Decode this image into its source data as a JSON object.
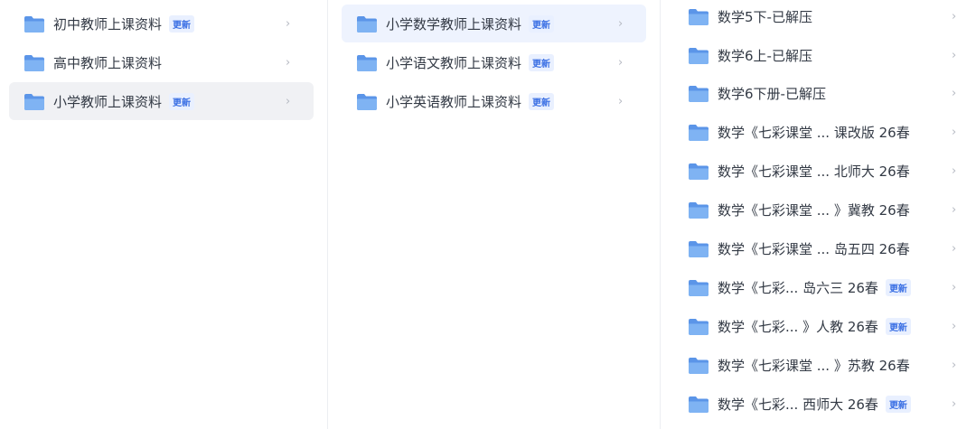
{
  "colors": {
    "accent": "#3a6fe4",
    "folder": "#6aa2ee",
    "selected_bg_1": "#f0f1f4",
    "selected_bg_2": "#eef3fe"
  },
  "col1": {
    "items": [
      {
        "label": "初中教师上课资料",
        "badge": "更新"
      },
      {
        "label": "高中教师上课资料",
        "badge": ""
      },
      {
        "label": "小学教师上课资料",
        "badge": "更新"
      }
    ],
    "chevron": "›"
  },
  "col2": {
    "items": [
      {
        "label": "小学数学教师上课资料",
        "badge": "更新"
      },
      {
        "label": "小学语文教师上课资料",
        "badge": "更新"
      },
      {
        "label": "小学英语教师上课资料",
        "badge": "更新"
      }
    ],
    "chevron": "›"
  },
  "col3": {
    "items": [
      {
        "label": "数学5下-已解压",
        "badge": ""
      },
      {
        "label": "数学6上-已解压",
        "badge": ""
      },
      {
        "label": "数学6下册-已解压",
        "badge": ""
      },
      {
        "label": "数学《七彩课堂 ...  课改版 26春",
        "badge": ""
      },
      {
        "label": "数学《七彩课堂 ...  北师大 26春",
        "badge": ""
      },
      {
        "label": "数学《七彩课堂 ...  》冀教 26春",
        "badge": ""
      },
      {
        "label": "数学《七彩课堂 ...  岛五四 26春",
        "badge": ""
      },
      {
        "label": "数学《七彩...  岛六三 26春",
        "badge": "更新"
      },
      {
        "label": "数学《七彩...  》人教 26春",
        "badge": "更新"
      },
      {
        "label": "数学《七彩课堂 ...  》苏教 26春",
        "badge": ""
      },
      {
        "label": "数学《七彩...  西师大 26春",
        "badge": "更新"
      }
    ],
    "chevron": "›"
  }
}
